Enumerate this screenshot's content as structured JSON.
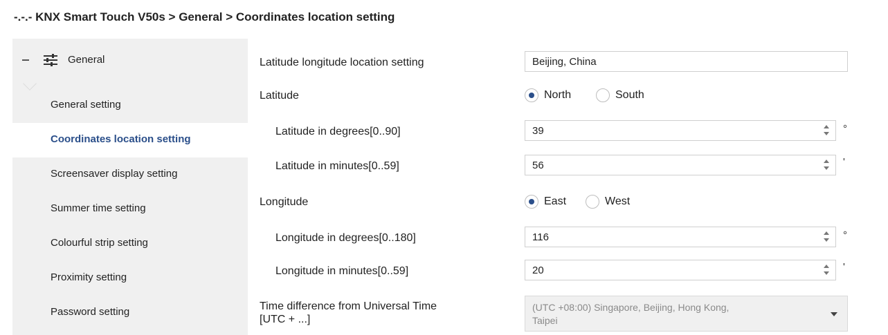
{
  "window": {
    "title": "-.-.- KNX Smart Touch V50s > General > Coordinates location setting"
  },
  "sidebar": {
    "group": {
      "label": "General",
      "icon": "tune-icon",
      "expanded": true
    },
    "items": [
      {
        "label": "General setting"
      },
      {
        "label": "Coordinates location setting",
        "active": true
      },
      {
        "label": "Screensaver display setting"
      },
      {
        "label": "Summer time setting"
      },
      {
        "label": "Colourful strip setting"
      },
      {
        "label": "Proximity setting"
      },
      {
        "label": "Password setting"
      }
    ]
  },
  "form": {
    "location": {
      "label": "Latitude longitude location setting",
      "value": "Beijing, China"
    },
    "latitude": {
      "label": "Latitude",
      "options": [
        "North",
        "South"
      ],
      "selected": "North"
    },
    "lat_degrees": {
      "label": "Latitude in degrees[0..90]",
      "value": "39",
      "unit": "°"
    },
    "lat_minutes": {
      "label": "Latitude in minutes[0..59]",
      "value": "56",
      "unit": "'"
    },
    "longitude": {
      "label": "Longitude",
      "options": [
        "East",
        "West"
      ],
      "selected": "East"
    },
    "lon_degrees": {
      "label": "Longitude in degrees[0..180]",
      "value": "116",
      "unit": "°"
    },
    "lon_minutes": {
      "label": "Longitude in minutes[0..59]",
      "value": "20",
      "unit": "'"
    },
    "time_diff": {
      "label_line1": "Time difference from Universal Time",
      "label_line2": "[UTC + ...]",
      "value_line1": "(UTC +08:00) Singapore, Beijing, Hong Kong,",
      "value_line2": "Taipei"
    }
  },
  "colors": {
    "accent": "#2b4f8a",
    "sidebar_bg": "#f0f0f0",
    "disabled_text": "#8a8a8a"
  }
}
